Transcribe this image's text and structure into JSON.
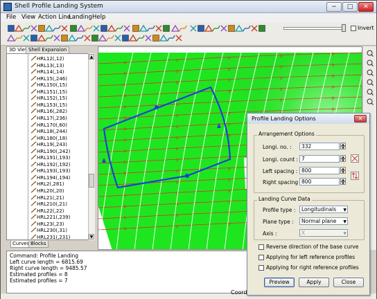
{
  "app": {
    "title": "Shell Profile Landing System",
    "window_buttons": {
      "minimize": "−",
      "maximize": "□",
      "close": "✕"
    }
  },
  "menu": [
    "File",
    "View",
    "Action Line",
    "Landing",
    "Help"
  ],
  "toolbar": {
    "invert_label": "Invert"
  },
  "left_panel": {
    "tabs": [
      "3D View",
      "Shell Expansion"
    ],
    "bottom_tabs": [
      "Curves",
      "Blocks"
    ],
    "items": [
      "HRL12(,12)",
      "HRL13(,13)",
      "HRL14(,14)",
      "HRL15(,246)",
      "HRL150(,15)",
      "HRL151(,15)",
      "HRL152(,15)",
      "HRL153(,15)",
      "HRL16(,282)",
      "HRL17(,236)",
      "HRL170(,60)",
      "HRL18(,244)",
      "HRL180(,18)",
      "HRL19(,243)",
      "HRL190(,242)",
      "HRL191(,193)",
      "HRL192(,192)",
      "HRL193(,193)",
      "HRL194(,194)",
      "HRL2(,281)",
      "HRL20(,20)",
      "HRL21(,21)",
      "HRL210(,21)",
      "HRL22(,22)",
      "HRL221(,239)",
      "HRL23(,23)",
      "HRL230(,31)",
      "HRL231(,231)"
    ]
  },
  "console": {
    "lines": [
      "Command: Profile Landing",
      "Left curve length = 6815.69",
      "Right curve length = 9485.57",
      "Estimated profiles = 8",
      "Estimated profiles = 7"
    ]
  },
  "status": {
    "coord_label": "Coord."
  },
  "dialog": {
    "title": "Profile Landing Options",
    "close": "✕",
    "arrangement": {
      "title": "Arrangement Options",
      "longi_no": {
        "label": "Longi. no. :",
        "value": "332"
      },
      "longi_count": {
        "label": "Longi. count :",
        "value": "7"
      },
      "left_spacing": {
        "label": "Left spacing :",
        "value": "800"
      },
      "right_spacing": {
        "label": "Right spacing :",
        "value": "800"
      }
    },
    "landing": {
      "title": "Landing Curve Data",
      "profile_type": {
        "label": "Profile type :",
        "value": "Longitudinals"
      },
      "plane_type": {
        "label": "Plane type :",
        "value": "Normal plane"
      },
      "axis": {
        "label": "Axis :",
        "value": "X"
      }
    },
    "checks": [
      "Reverse direction of the base curve",
      "Applying for left reference profiles",
      "Applying for right reference profiles"
    ],
    "buttons": {
      "preview": "Preview",
      "apply": "Apply",
      "close": "Close"
    }
  },
  "colors": {
    "surface_green": "#1ee61e",
    "curve_blue": "#1f3fd6",
    "frame_red": "#d23a2a",
    "dialog_bg": "#ece9d8"
  }
}
